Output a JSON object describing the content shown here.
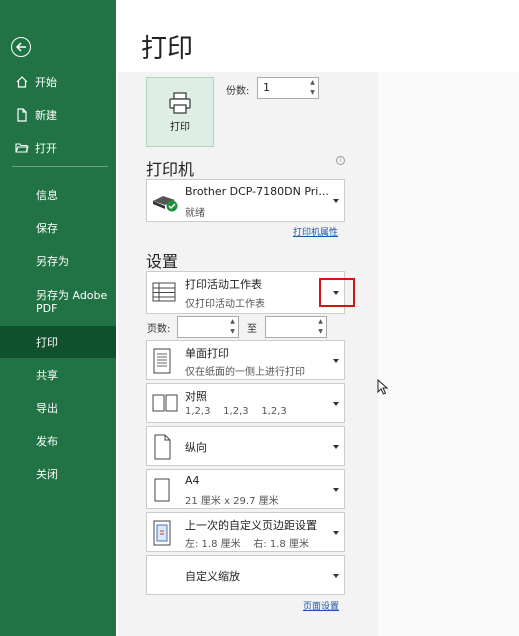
{
  "title": "打印",
  "nav": {
    "items": [
      {
        "label": "开始",
        "icon": "home-icon"
      },
      {
        "label": "新建",
        "icon": "new-document-icon"
      },
      {
        "label": "打开",
        "icon": "folder-open-icon"
      },
      {
        "label": "信息"
      },
      {
        "label": "保存"
      },
      {
        "label": "另存为"
      },
      {
        "label": "另存为 Adobe PDF"
      },
      {
        "label": "打印"
      },
      {
        "label": "共享"
      },
      {
        "label": "导出"
      },
      {
        "label": "发布"
      },
      {
        "label": "关闭"
      }
    ],
    "active": "打印"
  },
  "print": {
    "button_label": "打印",
    "copies_label": "份数:",
    "copies_value": "1"
  },
  "printer": {
    "heading": "打印机",
    "name": "Brother DCP-7180DN Pri...",
    "status": "就绪",
    "properties_link": "打印机属性"
  },
  "settings": {
    "heading": "设置",
    "scope": {
      "title": "打印活动工作表",
      "subtitle": "仅打印活动工作表"
    },
    "pages_label": "页数:",
    "to_label": "至",
    "sides": {
      "title": "单面打印",
      "subtitle": "仅在纸面的一侧上进行打印"
    },
    "collate": {
      "title": "对照",
      "subtitle": "1,2,3    1,2,3    1,2,3"
    },
    "orientation": {
      "title": "纵向"
    },
    "paper": {
      "title": "A4",
      "subtitle": "21 厘米 x 29.7 厘米"
    },
    "margins": {
      "title": "上一次的自定义页边距设置",
      "subtitle": "左: 1.8 厘米    右: 1.8 厘米"
    },
    "scaling": {
      "title": "自定义缩放"
    },
    "page_setup_link": "页面设置"
  },
  "colors": {
    "sidebar": "#217346",
    "active": "#10502d",
    "highlight": "#d11414"
  }
}
